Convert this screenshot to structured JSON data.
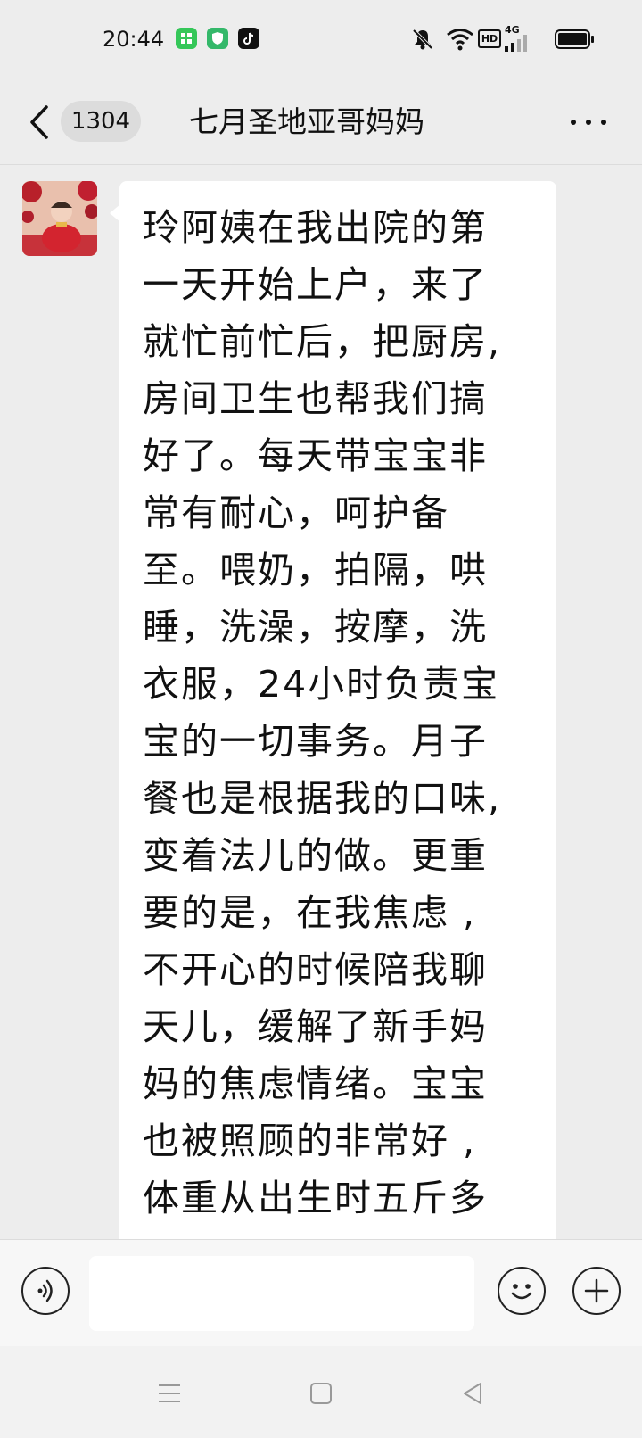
{
  "status_bar": {
    "time": "20:44",
    "network": "4G",
    "hd_badge": "HD",
    "icons": [
      "app-green-icon",
      "shield-app-icon",
      "tiktok-icon",
      "mute-icon",
      "wifi-icon",
      "signal-icon",
      "battery-icon"
    ]
  },
  "header": {
    "back_icon": "chevron-left-icon",
    "unread_count": "1304",
    "title": "七月圣地亚哥妈妈",
    "more_icon": "more-dots-icon"
  },
  "message": {
    "sender_avatar": "avatar",
    "lines": [
      "玲阿姨在我出院的第",
      "一天开始上户，来了",
      "就忙前忙后，把厨房,",
      "房间卫生也帮我们搞",
      "好了。每天带宝宝非",
      "常有耐心，呵护备",
      "至。喂奶，拍隔，哄",
      "睡，洗澡，按摩，洗",
      "衣服，24小时负责宝",
      "宝的一切事务。月子",
      "餐也是根据我的口味,",
      "变着法儿的做。更重",
      "要的是，在我焦虑 ,",
      "不开心的时候陪我聊",
      "天儿，缓解了新手妈",
      "妈的焦虑情绪。宝宝",
      "也被照顾的非常好 ,",
      "体重从出生时五斤多"
    ]
  },
  "input_bar": {
    "voice_icon": "voice-icon",
    "input_value": "",
    "emoji_icon": "emoji-icon",
    "plus_icon": "plus-icon"
  },
  "nav_bar": {
    "icons": [
      "menu-icon",
      "home-square-icon",
      "back-triangle-icon"
    ]
  },
  "colors": {
    "background": "#ededed",
    "bubble": "#ffffff",
    "badge": "#dcdcdc"
  }
}
